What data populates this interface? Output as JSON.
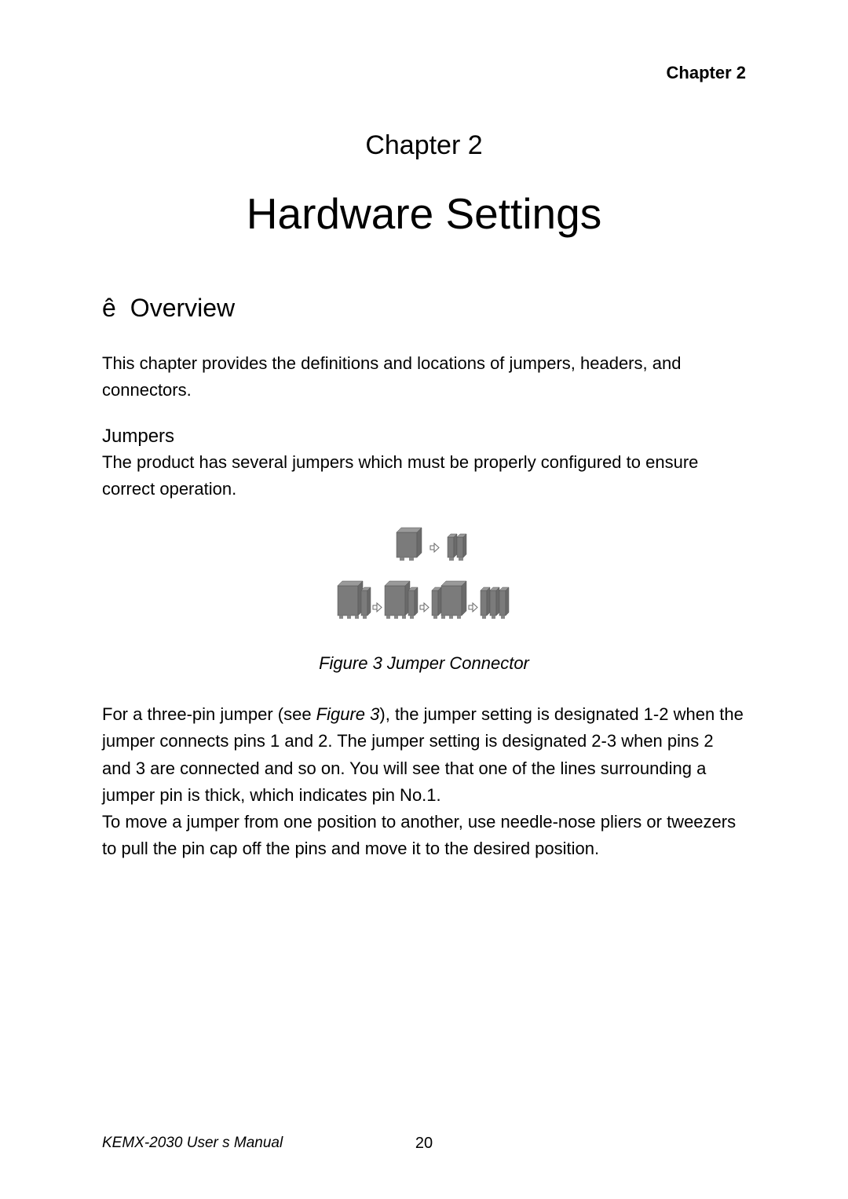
{
  "header": {
    "right": "Chapter  2"
  },
  "chapter": {
    "label": "Chapter 2",
    "title": "Hardware Settings"
  },
  "section": {
    "bullet": "ê",
    "heading": "Overview",
    "intro": "This chapter provides the definitions and locations of jumpers, headers, and connectors."
  },
  "jumpers": {
    "heading": "Jumpers",
    "intro": "The product has several jumpers which must be properly configured to ensure correct operation.",
    "figure_caption": "Figure 3 Jumper Connector",
    "para_1_pre": "For a three-pin jumper (see ",
    "para_1_ref": "Figure 3",
    "para_1_post": "), the jumper setting is designated  1-2  when the jumper connects pins 1 and 2. The jumper setting is designated  2-3  when pins 2 and 3 are connected and so on. You will see that one of the lines surrounding a jumper pin is thick, which indicates pin No.1.",
    "para_2": "To move a jumper from one position to another, use needle-nose pliers or tweezers to pull the pin cap off the pins and move it to the desired position."
  },
  "footer": {
    "left": "KEMX-2030 User s Manual",
    "page": "20"
  }
}
